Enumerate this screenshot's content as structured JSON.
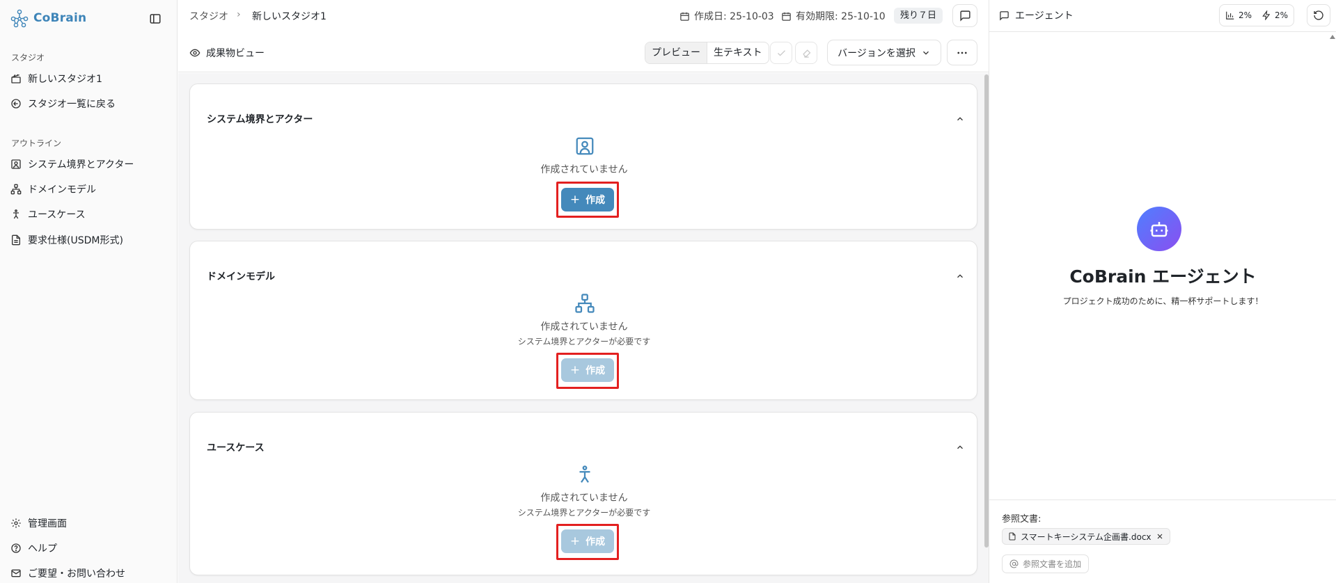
{
  "app": {
    "brand": "CoBrain"
  },
  "sidebar": {
    "section_studio": "スタジオ",
    "studio_items": [
      {
        "label": "新しいスタジオ1",
        "icon": "clapperboard-icon"
      },
      {
        "label": "スタジオ一覧に戻る",
        "icon": "arrow-left-circle-icon"
      }
    ],
    "section_outline": "アウトライン",
    "outline_items": [
      {
        "label": "システム境界とアクター",
        "icon": "user-square-icon"
      },
      {
        "label": "ドメインモデル",
        "icon": "network-icon"
      },
      {
        "label": "ユースケース",
        "icon": "person-standing-icon"
      },
      {
        "label": "要求仕様(USDM形式)",
        "icon": "file-text-icon"
      }
    ],
    "bottom_items": [
      {
        "label": "管理画面",
        "icon": "gear-icon"
      },
      {
        "label": "ヘルプ",
        "icon": "help-circle-icon"
      },
      {
        "label": "ご要望・お問い合わせ",
        "icon": "mail-icon"
      }
    ]
  },
  "header": {
    "breadcrumb_root": "スタジオ",
    "breadcrumb_current": "新しいスタジオ1",
    "created": "作成日: 25-10-03",
    "expires": "有効期限: 25-10-10",
    "remaining": "残り７日"
  },
  "toolbar": {
    "view_title": "成果物ビュー",
    "preview_label": "プレビュー",
    "raw_label": "生テキスト",
    "version_label": "バージョンを選択"
  },
  "main": {
    "cards": [
      {
        "title": "システム境界とアクター",
        "empty": "作成されていません",
        "sub": "",
        "button": "作成",
        "enabled": true
      },
      {
        "title": "ドメインモデル",
        "empty": "作成されていません",
        "sub": "システム境界とアクターが必要です",
        "button": "作成",
        "enabled": false
      },
      {
        "title": "ユースケース",
        "empty": "作成されていません",
        "sub": "システム境界とアクターが必要です",
        "button": "作成",
        "enabled": false
      }
    ]
  },
  "agent": {
    "title": "エージェント",
    "usage_1": "2%",
    "usage_2": "2%",
    "name": "CoBrain エージェント",
    "subtitle": "プロジェクト成功のために、精一杯サポートします！",
    "ref_label": "参照文書:",
    "ref_doc": "スマートキーシステム企画書.docx",
    "add_ref": "参照文書を追加"
  },
  "colors": {
    "brand": "#3d84b8",
    "primary_button": "#4489bb",
    "disabled_button": "#a8c8de",
    "highlight": "#e32020"
  }
}
